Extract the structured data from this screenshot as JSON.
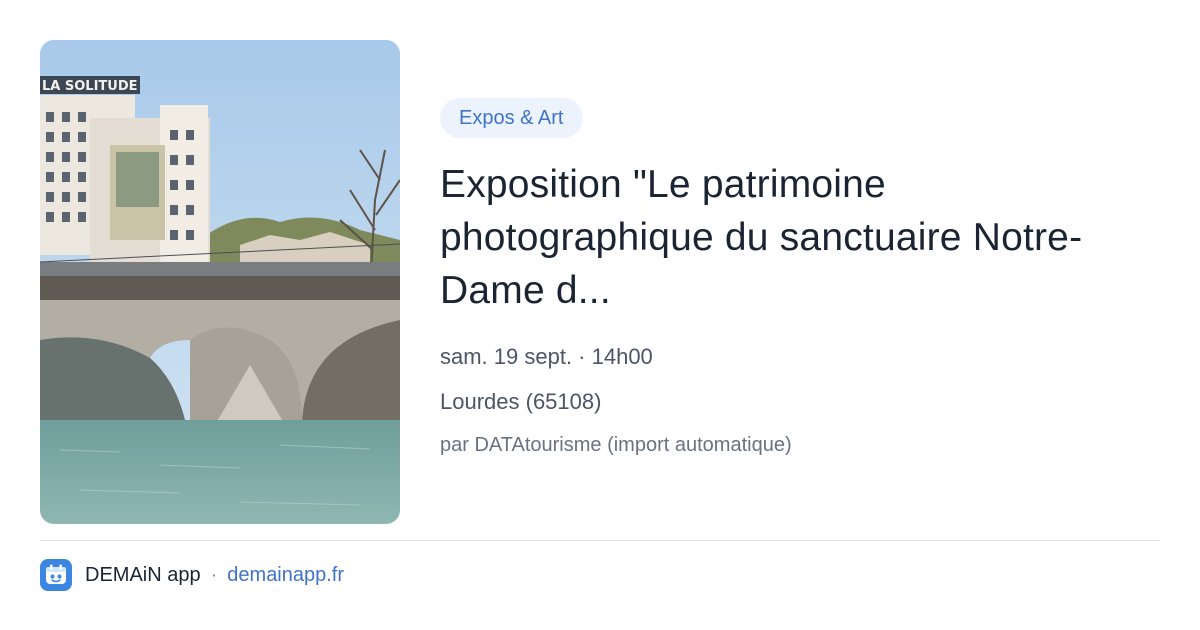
{
  "image": {
    "alt": "",
    "sign_text": "LA SOLITUDE"
  },
  "category": {
    "label": "Expos & Art"
  },
  "event": {
    "title": "Exposition \"Le patrimoine photographique du sanctuaire Notre-Dame d...",
    "datetime": "sam. 19 sept. · 14h00",
    "location": "Lourdes (65108)",
    "source": "par DATAtourisme (import automatique)"
  },
  "footer": {
    "app_name": "DEMAiN app",
    "separator": "·",
    "domain": "demainapp.fr",
    "icon": "demain-app-logo-icon"
  },
  "colors": {
    "accent": "#3f73c7",
    "chip_bg": "#edf3fc",
    "title": "#1b2433",
    "app_icon": "#3a86e0"
  }
}
